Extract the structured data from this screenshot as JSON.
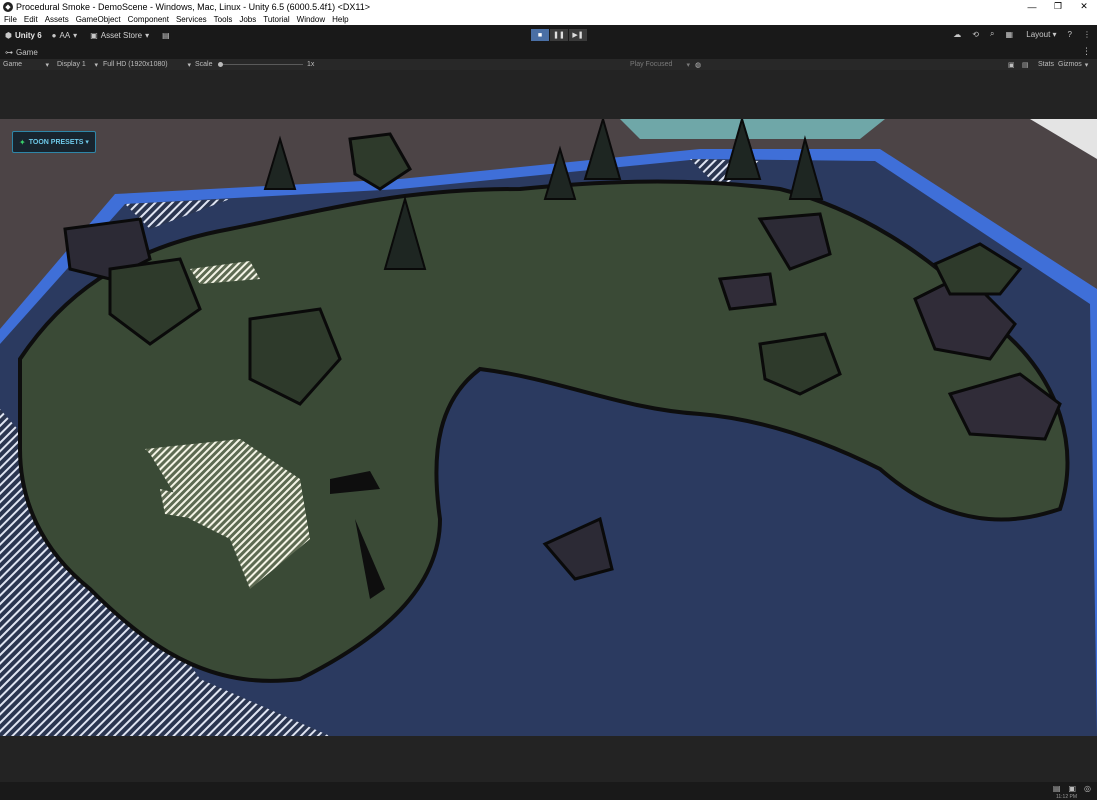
{
  "window": {
    "title": "Procedural Smoke - DemoScene - Windows, Mac, Linux - Unity 6.5 (6000.5.4f1) <DX11>",
    "controls": {
      "minimize": "—",
      "maximize": "❐",
      "close": "✕"
    }
  },
  "menu": [
    "File",
    "Edit",
    "Assets",
    "GameObject",
    "Component",
    "Services",
    "Tools",
    "Jobs",
    "Tutorial",
    "Window",
    "Help"
  ],
  "toolbar": {
    "unity_label": "Unity 6",
    "account_label": "AA",
    "asset_store_label": "Asset Store",
    "layout_label": "Layout",
    "play_buttons": [
      "■",
      "❚❚",
      "▶❚"
    ]
  },
  "tab": {
    "label": "Game"
  },
  "gamebar": {
    "view_select": "Game",
    "display_select": "Display 1",
    "resolution_select": "Full HD (1920x1080)",
    "scale_label": "Scale",
    "scale_value_label": "1x",
    "scale_value": 0.0,
    "play_mode_select": "Play Focused",
    "stats_label": "Stats",
    "gizmos_label": "Gizmos"
  },
  "overlay": {
    "toon_presets_label": "TOON PRESETS ▾"
  },
  "statusbar": {
    "clock": "11:12 PM"
  },
  "colors": {
    "accent_play": "#4a6fa5",
    "toon_button_border": "#2e86a8",
    "toon_button_text": "#6ec8e8",
    "terrain": "#3a4a36",
    "water": "#2b3a60",
    "border_blue": "#3f6fd8"
  }
}
